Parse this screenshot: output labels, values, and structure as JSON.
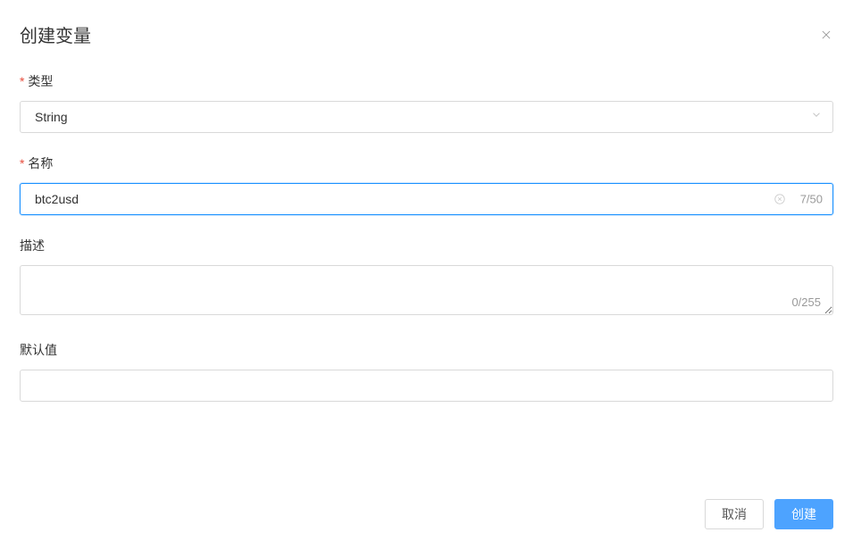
{
  "modal": {
    "title": "创建变量"
  },
  "form": {
    "type": {
      "label": "类型",
      "value": "String"
    },
    "name": {
      "label": "名称",
      "value": "btc2usd",
      "counter": "7/50"
    },
    "description": {
      "label": "描述",
      "value": "",
      "counter": "0/255"
    },
    "defaultValue": {
      "label": "默认值",
      "value": ""
    }
  },
  "footer": {
    "cancel": "取消",
    "create": "创建"
  }
}
